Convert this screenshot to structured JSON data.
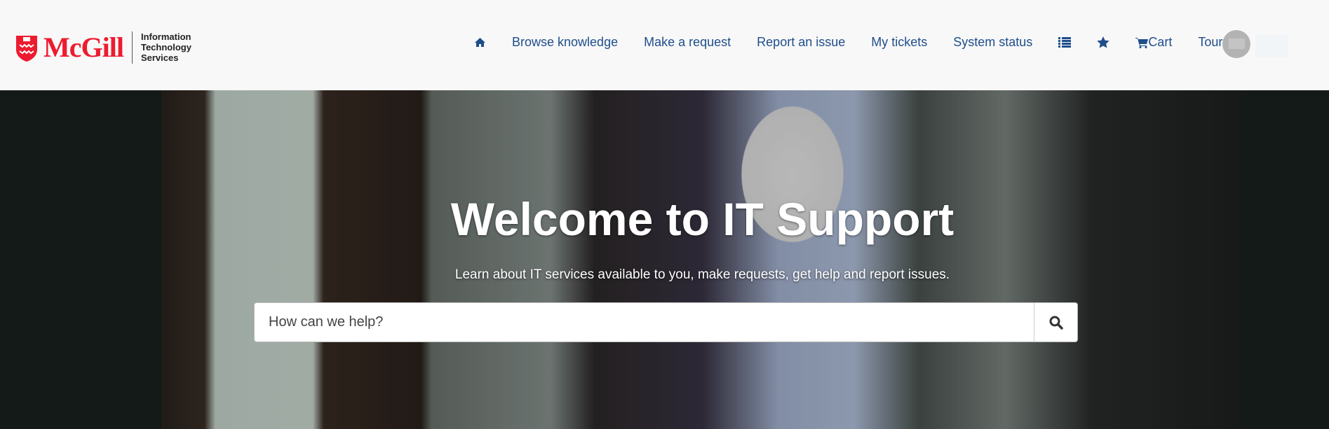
{
  "brand": {
    "name": "McGill",
    "unit_lines": [
      "Information",
      "Technology",
      "Services"
    ],
    "color": "#ed1b2f"
  },
  "nav": {
    "items": [
      {
        "label": "",
        "icon": "home-icon"
      },
      {
        "label": "Browse knowledge"
      },
      {
        "label": "Make a request"
      },
      {
        "label": "Report an issue"
      },
      {
        "label": "My tickets"
      },
      {
        "label": "System status"
      },
      {
        "label": "",
        "icon": "list-icon"
      },
      {
        "label": "",
        "icon": "star-icon"
      },
      {
        "label": "Cart",
        "icon": "cart-icon"
      },
      {
        "label": "Tours",
        "badge": "red-dot"
      }
    ],
    "color": "#1f4e8c"
  },
  "hero": {
    "title": "Welcome to IT Support",
    "subtitle": "Learn about IT services available to you, make requests, get help and report issues."
  },
  "search": {
    "placeholder": "How can we help?",
    "value": "",
    "icon": "search-icon"
  }
}
